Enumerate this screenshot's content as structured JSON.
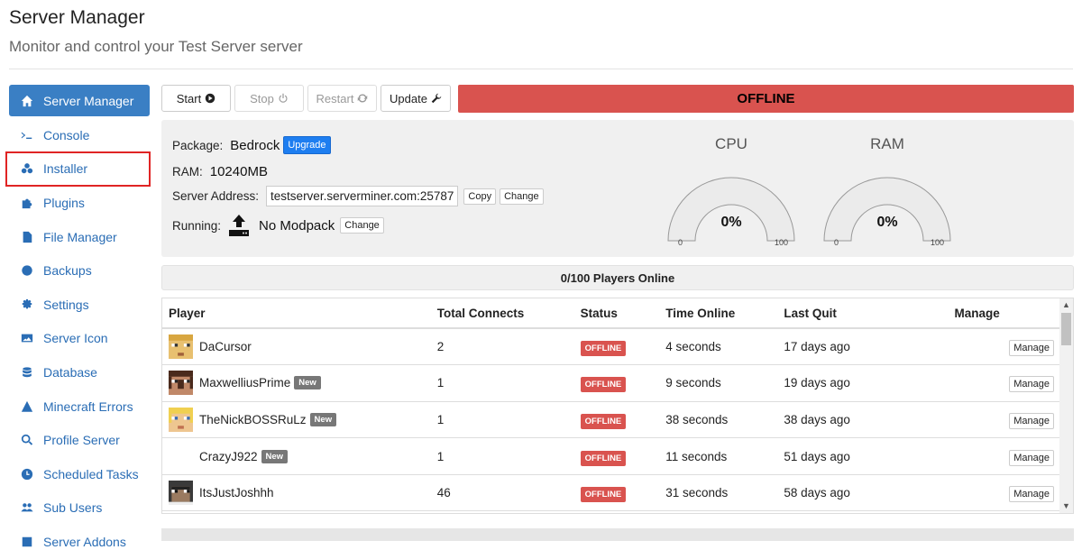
{
  "header": {
    "title": "Server Manager",
    "subtitle": "Monitor and control your Test Server server"
  },
  "sidebar": {
    "items": [
      {
        "label": "Server Manager",
        "icon": "home-icon",
        "active": true
      },
      {
        "label": "Console",
        "icon": "terminal-icon"
      },
      {
        "label": "Installer",
        "icon": "cubes-icon",
        "highlighted": true
      },
      {
        "label": "Plugins",
        "icon": "puzzle-icon"
      },
      {
        "label": "File Manager",
        "icon": "file-icon"
      },
      {
        "label": "Backups",
        "icon": "globe-icon"
      },
      {
        "label": "Settings",
        "icon": "gear-icon"
      },
      {
        "label": "Server Icon",
        "icon": "image-icon"
      },
      {
        "label": "Database",
        "icon": "database-icon"
      },
      {
        "label": "Minecraft Errors",
        "icon": "warning-icon"
      },
      {
        "label": "Profile Server",
        "icon": "search-icon"
      },
      {
        "label": "Scheduled Tasks",
        "icon": "clock-icon"
      },
      {
        "label": "Sub Users",
        "icon": "users-icon"
      },
      {
        "label": "Server Addons",
        "icon": "addon-icon"
      }
    ]
  },
  "toolbar": {
    "start_label": "Start",
    "stop_label": "Stop",
    "restart_label": "Restart",
    "update_label": "Update",
    "status": "OFFLINE",
    "status_color": "#d9534f"
  },
  "info": {
    "package_label": "Package:",
    "package_value": "Bedrock",
    "upgrade_label": "Upgrade",
    "ram_label": "RAM:",
    "ram_value": "10240MB",
    "address_label": "Server Address:",
    "address_value": "testserver.serverminer.com:25787",
    "copy_label": "Copy",
    "address_change_label": "Change",
    "running_label": "Running:",
    "running_value": "No Modpack",
    "running_change_label": "Change"
  },
  "gauges": {
    "cpu": {
      "title": "CPU",
      "value": "0%",
      "min": "0",
      "max": "100"
    },
    "ram": {
      "title": "RAM",
      "value": "0%",
      "min": "0",
      "max": "100"
    }
  },
  "players": {
    "summary": "0/100 Players Online",
    "columns": [
      "Player",
      "Total Connects",
      "Status",
      "Time Online",
      "Last Quit",
      "Manage"
    ],
    "rows": [
      {
        "name": "DaCursor",
        "is_new": false,
        "connects": "2",
        "status": "OFFLINE",
        "time_online": "4 seconds",
        "last_quit": "17 days ago",
        "manage": "Manage",
        "avatar": "yellow-face"
      },
      {
        "name": "MaxwelliusPrime",
        "is_new": true,
        "new_label": "New",
        "connects": "1",
        "status": "OFFLINE",
        "time_online": "9 seconds",
        "last_quit": "19 days ago",
        "manage": "Manage",
        "avatar": "brown-face"
      },
      {
        "name": "TheNickBOSSRuLz",
        "is_new": true,
        "new_label": "New",
        "connects": "1",
        "status": "OFFLINE",
        "time_online": "38 seconds",
        "last_quit": "38 days ago",
        "manage": "Manage",
        "avatar": "blonde-face"
      },
      {
        "name": "CrazyJ922",
        "is_new": true,
        "new_label": "New",
        "connects": "1",
        "status": "OFFLINE",
        "time_online": "11 seconds",
        "last_quit": "51 days ago",
        "manage": "Manage",
        "avatar": "none"
      },
      {
        "name": "ItsJustJoshhh",
        "is_new": false,
        "connects": "46",
        "status": "OFFLINE",
        "time_online": "31 seconds",
        "last_quit": "58 days ago",
        "manage": "Manage",
        "avatar": "dark-face"
      }
    ]
  }
}
